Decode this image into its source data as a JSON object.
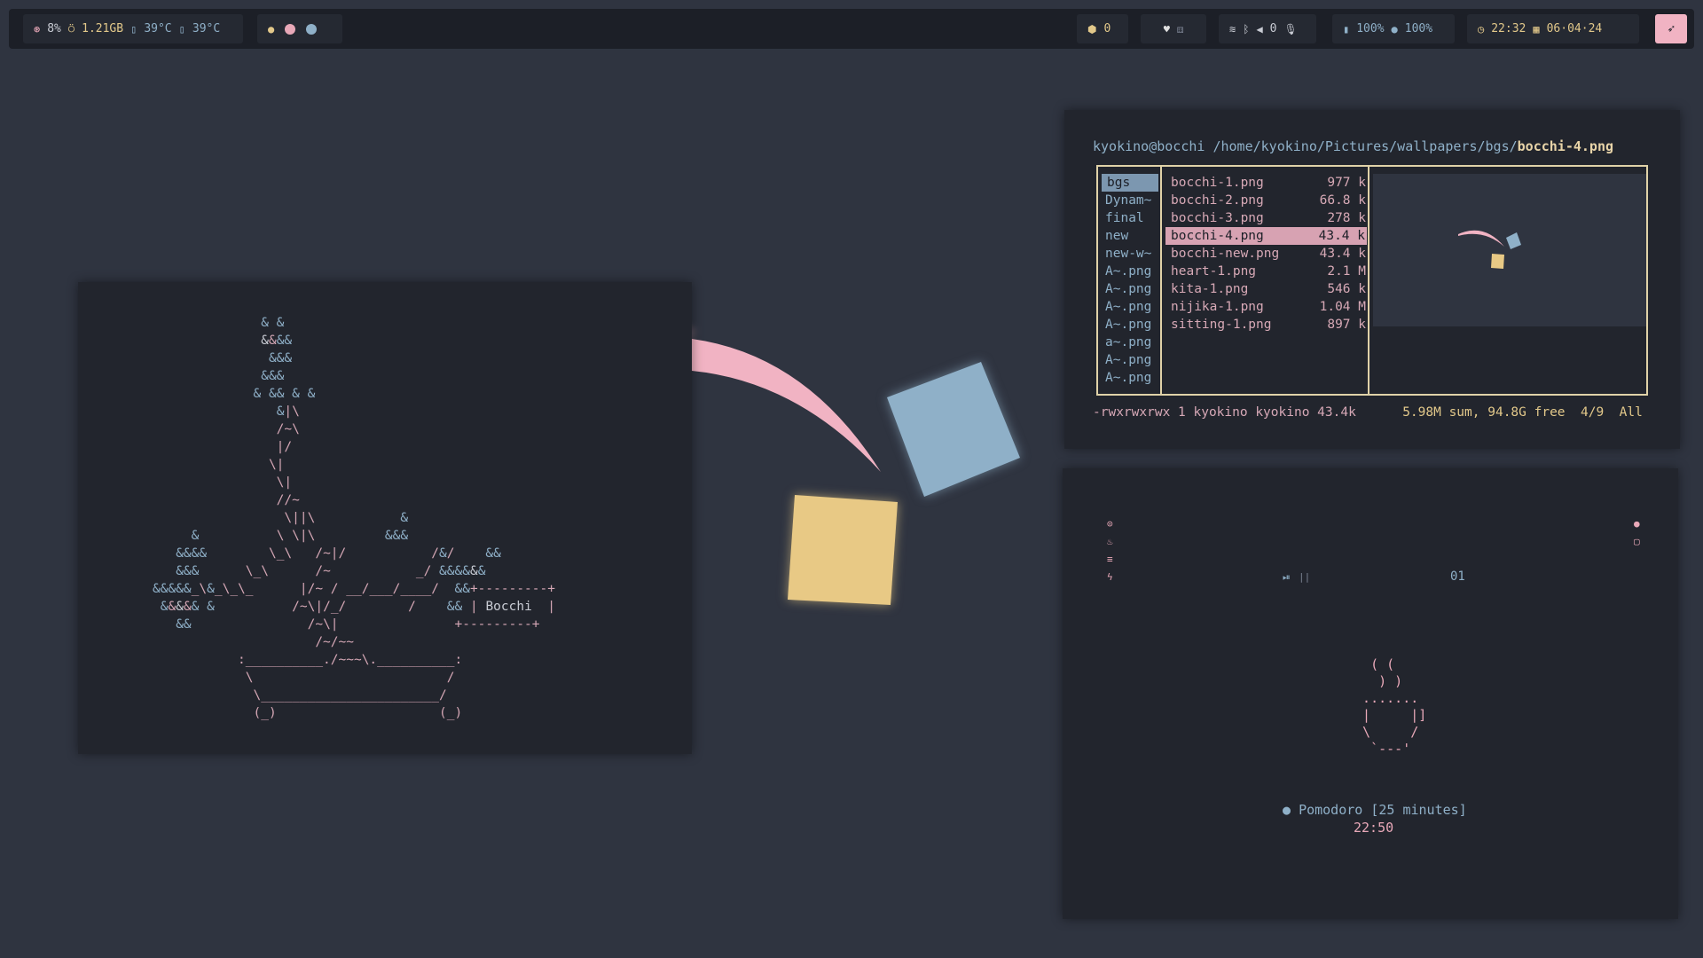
{
  "topbar": {
    "system": {
      "cpu": "8%",
      "ram": "1.21GB",
      "temp1": "39°C",
      "temp2": "39°C"
    },
    "workspaces": {
      "icons": [
        "apple-icon",
        "workspace-dot-pink",
        "workspace-dot-blue"
      ],
      "colors": [
        "#e8a8b8",
        "#8fb0c8"
      ]
    },
    "packages": {
      "count": "0"
    },
    "net": {
      "count": "0"
    },
    "battery": {
      "level": "100%",
      "brightness": "100%"
    },
    "clock": {
      "time": "22:32",
      "date": "06·04·24"
    },
    "accent": "#f1b3c3"
  },
  "ranger": {
    "user": "kyokino@bocchi",
    "path": "/home/kyokino/Pictures/wallpapers/bgs/",
    "file": "bocchi-4.png",
    "dirs": [
      {
        "name": "bgs",
        "selected": true
      },
      {
        "name": "Dynam~"
      },
      {
        "name": "final"
      },
      {
        "name": "new"
      },
      {
        "name": "new-w~"
      },
      {
        "name": "A~.png"
      },
      {
        "name": "A~.png"
      },
      {
        "name": "A~.png"
      },
      {
        "name": "A~.png"
      },
      {
        "name": "a~.png"
      },
      {
        "name": "A~.png"
      },
      {
        "name": "A~.png"
      }
    ],
    "files": [
      {
        "name": "bocchi-1.png",
        "size": " 977 k"
      },
      {
        "name": "bocchi-2.png",
        "size": "66.8 k"
      },
      {
        "name": "bocchi-3.png",
        "size": " 278 k"
      },
      {
        "name": "bocchi-4.png",
        "size": "43.4 k",
        "selected": true
      },
      {
        "name": "bocchi-new.png",
        "size": "43.4 k"
      },
      {
        "name": "heart-1.png",
        "size": " 2.1 M"
      },
      {
        "name": "kita-1.png",
        "size": " 546 k"
      },
      {
        "name": "nijika-1.png",
        "size": "1.04 M"
      },
      {
        "name": "sitting-1.png",
        "size": " 897 k"
      }
    ],
    "status_left": "-rwxrwxrwx 1 kyokino kyokino 43.4k",
    "status_right": "5.98M sum, 94.8G free  4/9  All"
  },
  "widget": {
    "track": "01",
    "pomodoro_label": "Pomodoro [25 minutes]",
    "pomodoro_time": "22:50"
  },
  "ascii_label": "Bocchi",
  "colors": {
    "pink": "#f1b3c3",
    "blue": "#8fb0c8",
    "yellow": "#e8c985",
    "bg": "#2f3440"
  }
}
